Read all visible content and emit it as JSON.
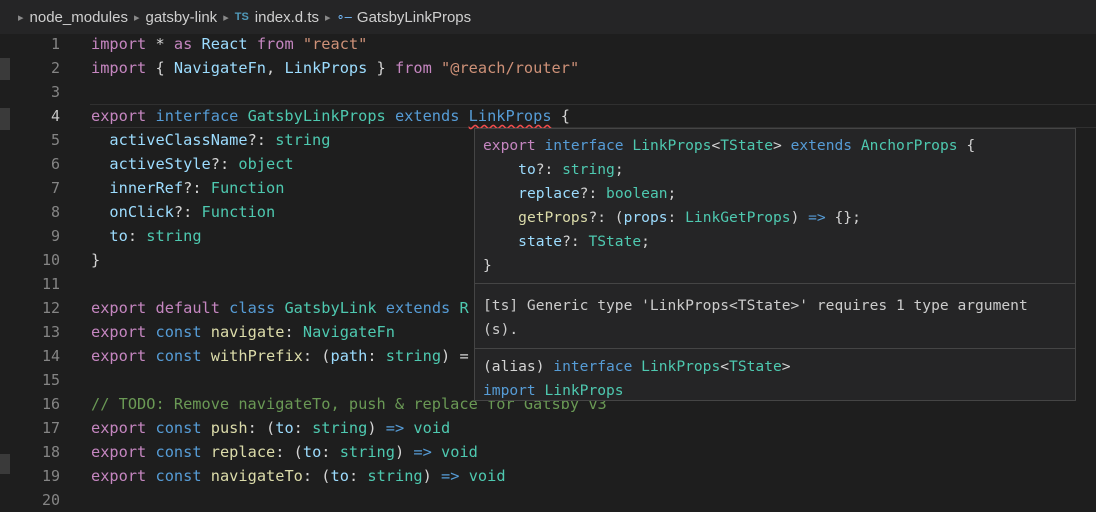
{
  "breadcrumb": {
    "items": [
      {
        "label": "node_modules"
      },
      {
        "label": "gatsby-link"
      },
      {
        "label": "index.d.ts",
        "badge": "TS"
      },
      {
        "label": "GatsbyLinkProps",
        "icon": "symbol-interface-icon"
      }
    ]
  },
  "editor": {
    "active_line": 4,
    "lines": [
      {
        "num": "1"
      },
      {
        "num": "2"
      },
      {
        "num": "3"
      },
      {
        "num": "4"
      },
      {
        "num": "5"
      },
      {
        "num": "6"
      },
      {
        "num": "7"
      },
      {
        "num": "8"
      },
      {
        "num": "9"
      },
      {
        "num": "10"
      },
      {
        "num": "11"
      },
      {
        "num": "12"
      },
      {
        "num": "13"
      },
      {
        "num": "14"
      },
      {
        "num": "15"
      },
      {
        "num": "16"
      },
      {
        "num": "17"
      },
      {
        "num": "18"
      },
      {
        "num": "19"
      },
      {
        "num": "20"
      }
    ],
    "code": {
      "l1": [
        "import",
        " * ",
        "as",
        " ",
        "React",
        " ",
        "from",
        " ",
        "\"react\""
      ],
      "l2": [
        "import",
        " { ",
        "NavigateFn",
        ", ",
        "LinkProps",
        " } ",
        "from",
        " ",
        "\"@reach/router\""
      ],
      "l4": [
        "export",
        " ",
        "interface",
        " ",
        "GatsbyLinkProps",
        " ",
        "extends",
        " ",
        "LinkProps",
        " {"
      ],
      "l5": [
        "  ",
        "activeClassName",
        "?: ",
        "string"
      ],
      "l6": [
        "  ",
        "activeStyle",
        "?: ",
        "object"
      ],
      "l7": [
        "  ",
        "innerRef",
        "?: ",
        "Function"
      ],
      "l8": [
        "  ",
        "onClick",
        "?: ",
        "Function"
      ],
      "l9": [
        "  ",
        "to",
        ": ",
        "string"
      ],
      "l10": [
        "}"
      ],
      "l12": [
        "export",
        " ",
        "default",
        " ",
        "class",
        " ",
        "GatsbyLink",
        " ",
        "extends",
        " ",
        "R"
      ],
      "l13": [
        "export",
        " ",
        "const",
        " ",
        "navigate",
        ": ",
        "NavigateFn"
      ],
      "l14": [
        "export",
        " ",
        "const",
        " ",
        "withPrefix",
        ": (",
        "path",
        ": ",
        "string",
        ") ="
      ],
      "l16": [
        "// TODO: Remove navigateTo, push & replace for Gatsby v3"
      ],
      "l17": [
        "export",
        " ",
        "const",
        " ",
        "push",
        ": (",
        "to",
        ": ",
        "string",
        ") ",
        "=>",
        " ",
        "void"
      ],
      "l18": [
        "export",
        " ",
        "const",
        " ",
        "replace",
        ": (",
        "to",
        ": ",
        "string",
        ") ",
        "=>",
        " ",
        "void"
      ],
      "l19": [
        "export",
        " ",
        "const",
        " ",
        "navigateTo",
        ": (",
        "to",
        ": ",
        "string",
        ") ",
        "=>",
        " ",
        "void"
      ]
    }
  },
  "hover": {
    "definition": {
      "h1": [
        "export",
        " ",
        "interface",
        " ",
        "LinkProps",
        "<",
        "TState",
        "> ",
        "extends",
        " ",
        "AnchorProps",
        " {"
      ],
      "h2": [
        "    ",
        "to",
        "?: ",
        "string",
        ";"
      ],
      "h3": [
        "    ",
        "replace",
        "?: ",
        "boolean",
        ";"
      ],
      "h4": [
        "    ",
        "getProps",
        "?: (",
        "props",
        ": ",
        "LinkGetProps",
        ") ",
        "=>",
        " {};"
      ],
      "h5": [
        "    ",
        "state",
        "?: ",
        "TState",
        ";"
      ],
      "h6": [
        "}"
      ]
    },
    "diagnostic": "[ts] Generic type 'LinkProps<TState>' requires 1 type argument (s).",
    "alias": {
      "a1": [
        "(alias) ",
        "interface",
        " ",
        "LinkProps",
        "<",
        "TState",
        ">"
      ],
      "a2": [
        "import",
        " ",
        "LinkProps"
      ]
    }
  }
}
